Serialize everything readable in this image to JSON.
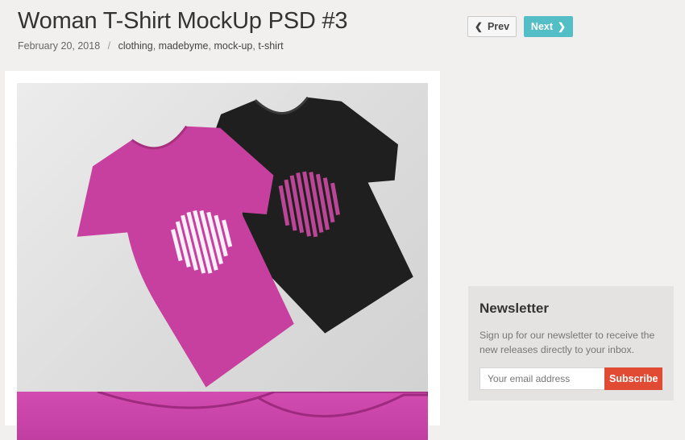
{
  "post": {
    "title": "Woman T-Shirt MockUp PSD #3",
    "date": "February 20, 2018",
    "separator": "/",
    "tags": [
      "clothing",
      "madebyme",
      "mock-up",
      "t-shirt"
    ]
  },
  "nav": {
    "prev_label": "Prev",
    "next_label": "Next",
    "prev_icon": "chevron-left-icon",
    "next_icon": "chevron-right-icon",
    "next_color": "#53bec6"
  },
  "image": {
    "description_icon": "t-shirt-mockup-image",
    "colors": [
      "#c8409f",
      "#1e1e1e"
    ]
  },
  "newsletter": {
    "title": "Newsletter",
    "text": "Sign up for our newsletter to receive the new releases directly to your inbox.",
    "placeholder": "Your email address",
    "button_label": "Subscribe",
    "button_color": "#e24b33"
  }
}
